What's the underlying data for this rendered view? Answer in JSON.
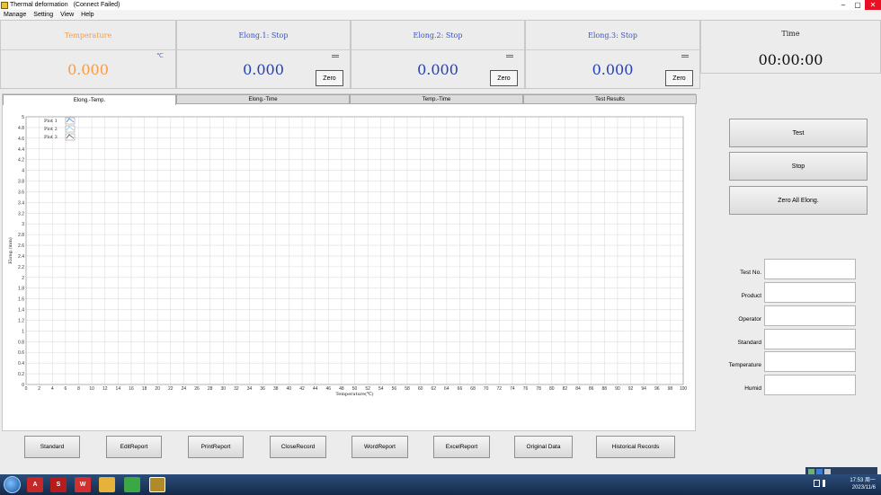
{
  "window": {
    "title": "Thermal deformation",
    "status": "(Connect Failed)"
  },
  "menu": [
    "Manage",
    "Setting",
    "View",
    "Help"
  ],
  "readouts": {
    "temperature": {
      "label": "Temperature",
      "unit": "℃",
      "value": "0.000"
    },
    "elong1": {
      "label": "Elong.1: Stop",
      "value": "0.000",
      "zero": "Zero"
    },
    "elong2": {
      "label": "Elong.2: Stop",
      "value": "0.000",
      "zero": "Zero"
    },
    "elong3": {
      "label": "Elong.3: Stop",
      "value": "0.000",
      "zero": "Zero"
    },
    "time": {
      "label": "Time",
      "value": "00:00:00"
    }
  },
  "tabs": [
    "Elong.-Temp.",
    "Elong.-Time",
    "Temp.-Time",
    "Test Results"
  ],
  "chart_data": {
    "type": "line",
    "xlabel": "Temperature(℃)",
    "ylabel": "Elong.(mm)",
    "xlim": [
      0,
      100
    ],
    "ylim": [
      0,
      5
    ],
    "x_ticks": [
      0,
      2,
      4,
      6,
      8,
      10,
      12,
      14,
      16,
      18,
      20,
      22,
      24,
      26,
      28,
      30,
      32,
      34,
      36,
      38,
      40,
      42,
      44,
      46,
      48,
      50,
      52,
      54,
      56,
      58,
      60,
      62,
      64,
      66,
      68,
      70,
      72,
      74,
      76,
      78,
      80,
      82,
      84,
      86,
      88,
      90,
      92,
      94,
      96,
      98,
      100
    ],
    "y_ticks": [
      0,
      0.2,
      0.4,
      0.6,
      0.8,
      1,
      1.2,
      1.4,
      1.6,
      1.8,
      2,
      2.2,
      2.4,
      2.6,
      2.8,
      3,
      3.2,
      3.4,
      3.6,
      3.8,
      4,
      4.2,
      4.4,
      4.6,
      4.8,
      5
    ],
    "grid": true,
    "legend_position": "top-left",
    "series": [
      {
        "name": "Plot 1",
        "values": []
      },
      {
        "name": "Plot 2",
        "values": []
      },
      {
        "name": "Plot 3",
        "values": []
      }
    ]
  },
  "actions": {
    "test": "Test",
    "stop": "Stop",
    "zero_all": "Zero All Elong."
  },
  "fields": [
    {
      "label": "Test No.",
      "value": ""
    },
    {
      "label": "Product",
      "value": ""
    },
    {
      "label": "Operator",
      "value": ""
    },
    {
      "label": "Standard",
      "value": ""
    },
    {
      "label": "Temperature",
      "value": ""
    },
    {
      "label": "Humid",
      "value": ""
    }
  ],
  "bottom_buttons": [
    "Standard",
    "EditReport",
    "PrintReport",
    "CloseRecord",
    "WordReport",
    "ExcelReport",
    "Original Data",
    "Historical Records"
  ],
  "taskbar": {
    "clock_time": "17:53 周一",
    "clock_date": "2023/11/6"
  },
  "colors": {
    "temp_accent": "#f59c46",
    "elong_accent": "#2641b8",
    "grid": "#dedede"
  }
}
